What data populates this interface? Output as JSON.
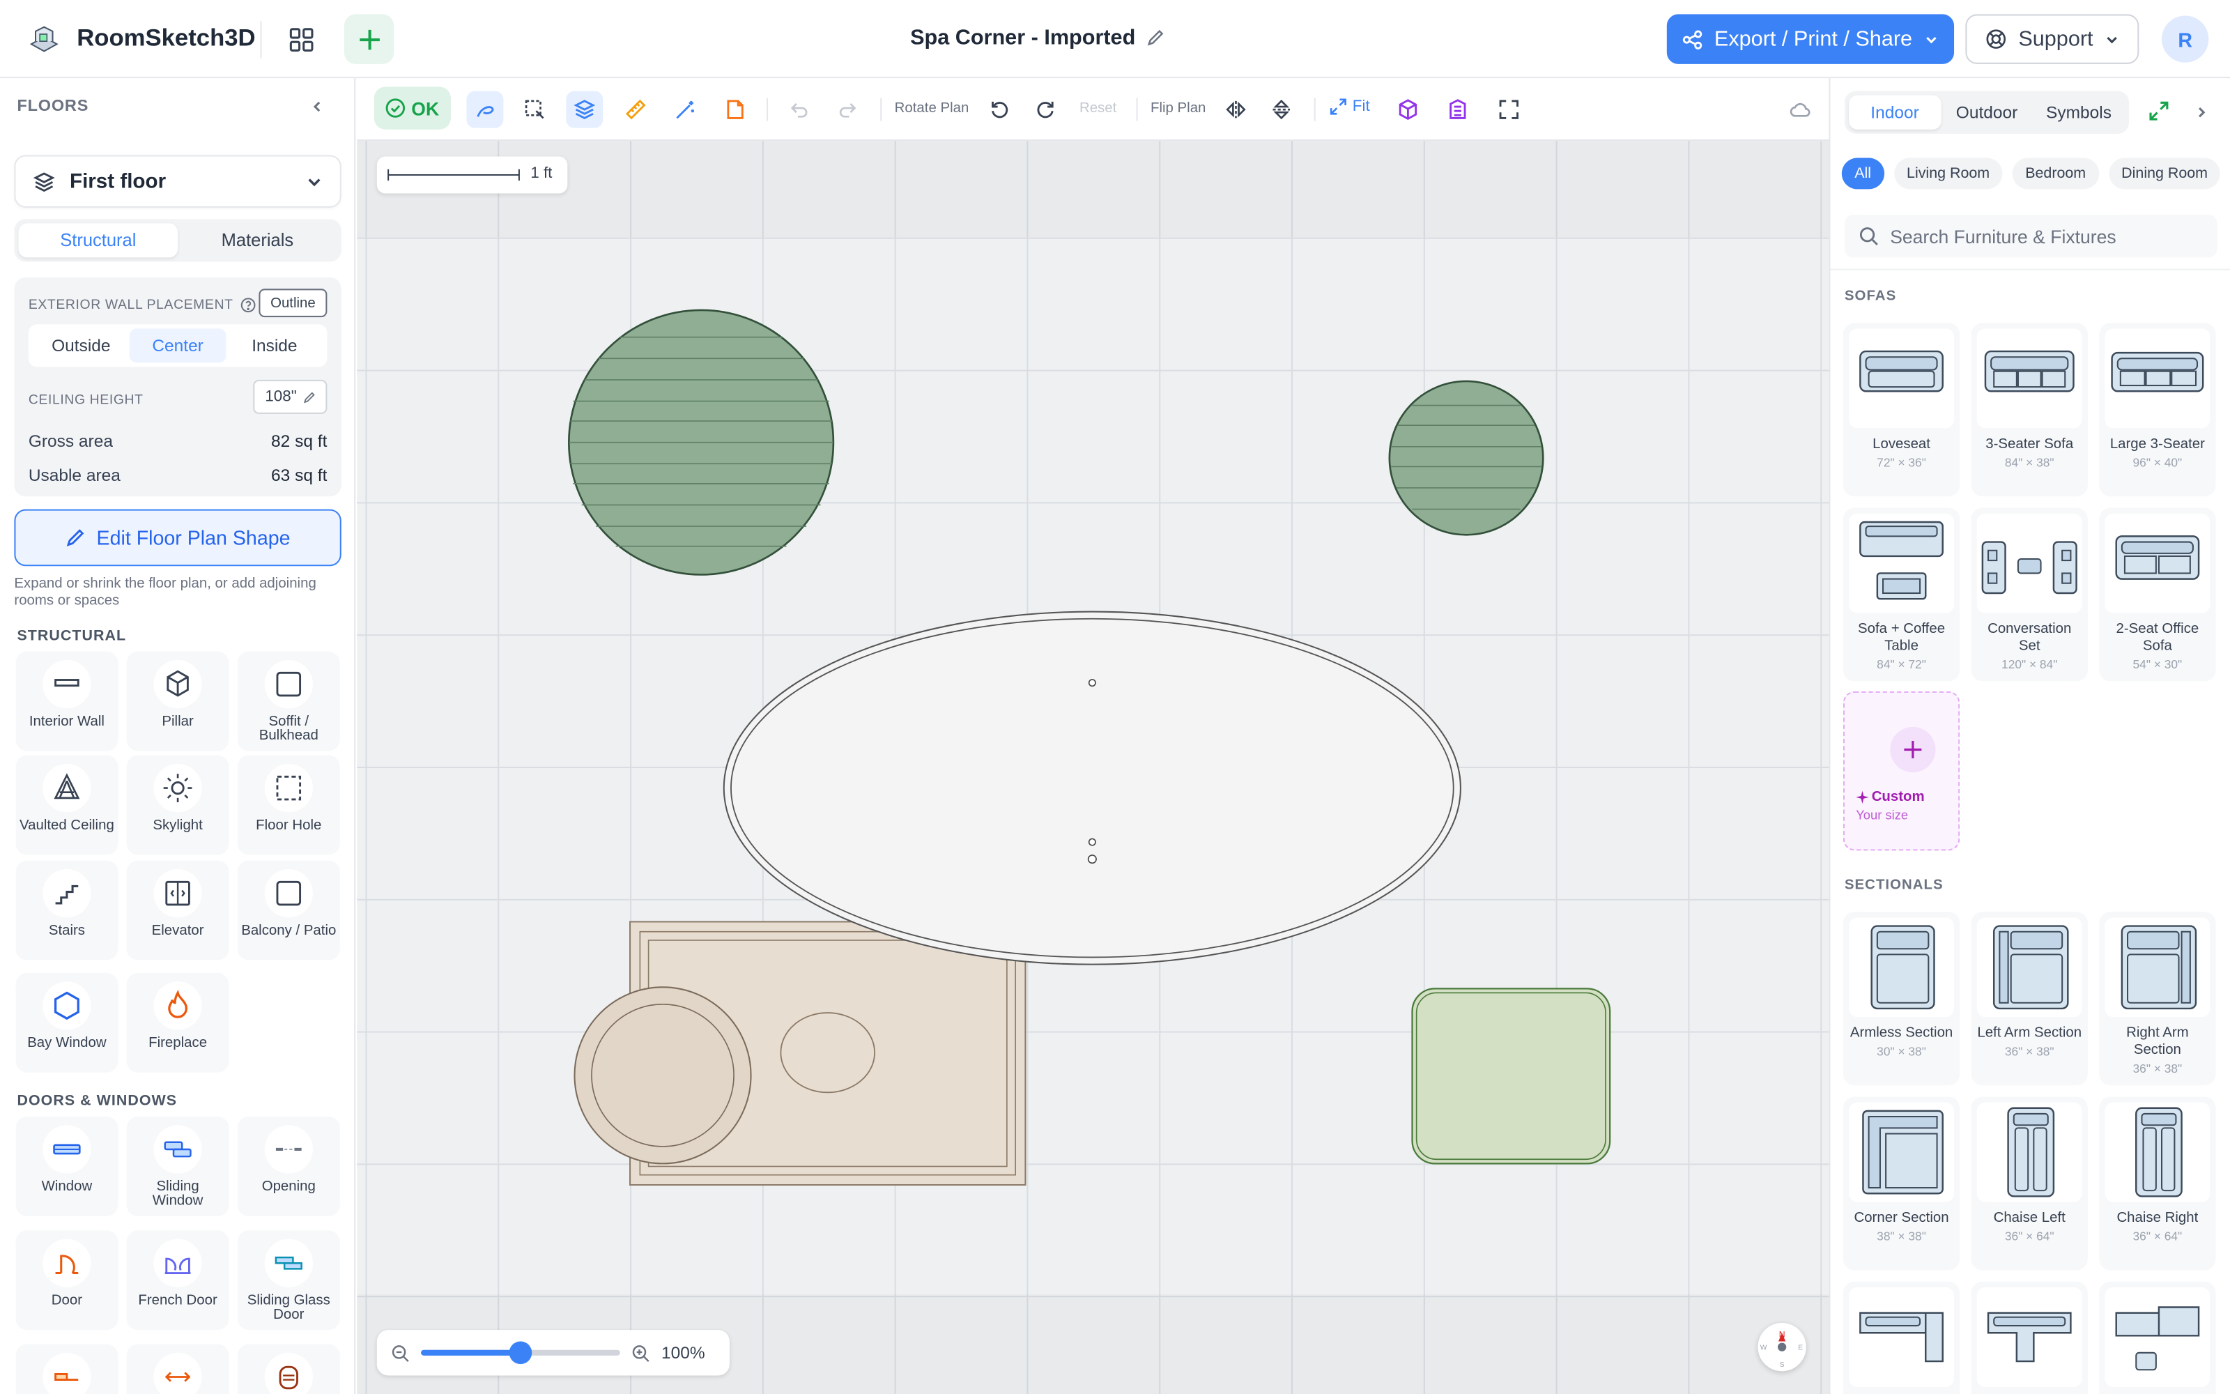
{
  "app": {
    "name": "RoomSketch3D"
  },
  "document": {
    "title": "Spa Corner - Imported"
  },
  "header": {
    "export_label": "Export / Print / Share",
    "support_label": "Support",
    "avatar_initial": "R"
  },
  "left_panel": {
    "title": "FLOORS",
    "floor": "First floor",
    "tabs": [
      "Structural",
      "Materials"
    ],
    "exterior_wall_label": "EXTERIOR WALL PLACEMENT",
    "outline_label": "Outline",
    "wall_options": [
      "Outside",
      "Center",
      "Inside"
    ],
    "ceiling_label": "CEILING HEIGHT",
    "ceiling_value": "108\"",
    "gross_label": "Gross area",
    "gross_value": "82 sq ft",
    "usable_label": "Usable area",
    "usable_value": "63 sq ft",
    "edit_label": "Edit Floor Plan Shape",
    "hint": "Expand or shrink the floor plan, or add adjoining rooms or spaces",
    "structural_title": "STRUCTURAL",
    "structural": [
      {
        "label": "Interior Wall",
        "icon": "interior-wall-icon"
      },
      {
        "label": "Pillar",
        "icon": "pillar-icon"
      },
      {
        "label": "Soffit / Bulkhead",
        "icon": "soffit-icon"
      },
      {
        "label": "Vaulted Ceiling",
        "icon": "vaulted-ceiling-icon"
      },
      {
        "label": "Skylight",
        "icon": "skylight-icon"
      },
      {
        "label": "Floor Hole",
        "icon": "floor-hole-icon"
      },
      {
        "label": "Stairs",
        "icon": "stairs-icon"
      },
      {
        "label": "Elevator",
        "icon": "elevator-icon"
      },
      {
        "label": "Balcony / Patio",
        "icon": "balcony-icon"
      },
      {
        "label": "Bay Window",
        "icon": "bay-window-icon"
      },
      {
        "label": "Fireplace",
        "icon": "fireplace-icon"
      }
    ],
    "doors_title": "DOORS & WINDOWS",
    "doors": [
      {
        "label": "Window",
        "icon": "window-icon"
      },
      {
        "label": "Sliding Window",
        "icon": "sliding-window-icon"
      },
      {
        "label": "Opening",
        "icon": "opening-icon"
      },
      {
        "label": "Door",
        "icon": "door-icon"
      },
      {
        "label": "French Door",
        "icon": "french-door-icon"
      },
      {
        "label": "Sliding Glass Door",
        "icon": "sliding-glass-door-icon"
      }
    ]
  },
  "toolbar": {
    "ok_label": "OK",
    "rotate_label": "Rotate Plan",
    "reset_label": "Reset",
    "flip_label": "Flip Plan",
    "fit_label": "Fit"
  },
  "canvas": {
    "scale_label": "1 ft",
    "zoom_label": "100%",
    "zoom_fraction": 0.5,
    "compass": {
      "n": "N",
      "s": "S",
      "e": "E",
      "w": "W"
    }
  },
  "right_panel": {
    "tabs": [
      "Indoor",
      "Outdoor",
      "Symbols"
    ],
    "chips": [
      "All",
      "Living Room",
      "Bedroom",
      "Dining Room"
    ],
    "search_placeholder": "Search Furniture & Fixtures",
    "sofas_title": "SOFAS",
    "sofas": [
      {
        "name": "Loveseat",
        "dims": "72\" × 36\""
      },
      {
        "name": "3-Seater Sofa",
        "dims": "84\" × 38\""
      },
      {
        "name": "Large 3-Seater",
        "dims": "96\" × 40\""
      },
      {
        "name": "Sofa + Coffee Table",
        "dims": "84\" × 72\""
      },
      {
        "name": "Conversation Set",
        "dims": "120\" × 84\""
      },
      {
        "name": "2-Seat Office Sofa",
        "dims": "54\" × 30\""
      }
    ],
    "custom": {
      "title": "Custom",
      "sub": "Your size"
    },
    "sectionals_title": "SECTIONALS",
    "sectionals": [
      {
        "name": "Armless Section",
        "dims": "30\" × 38\""
      },
      {
        "name": "Left Arm Section",
        "dims": "36\" × 38\""
      },
      {
        "name": "Right Arm Section",
        "dims": "36\" × 38\""
      },
      {
        "name": "Corner Section",
        "dims": "38\" × 38\""
      },
      {
        "name": "Chaise Left",
        "dims": "36\" × 64\""
      },
      {
        "name": "Chaise Right",
        "dims": "36\" × 64\""
      }
    ]
  },
  "colors": {
    "accent": "#3b82f6",
    "ok_green": "#16a34a",
    "plant_green": "#8fae93",
    "bath_beige": "#e8ddd1"
  }
}
